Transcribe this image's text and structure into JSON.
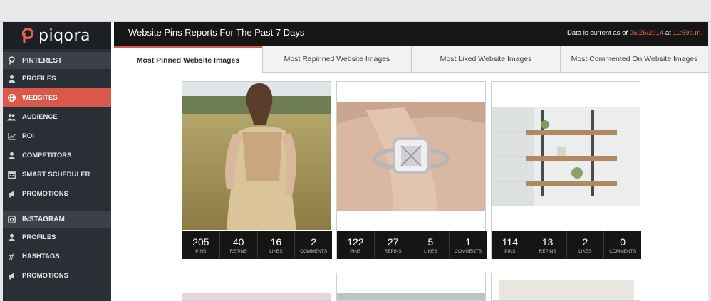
{
  "app": {
    "logo_text": "piqora"
  },
  "sidebar": {
    "pinterest_section": "PINTEREST",
    "pinterest_items": [
      {
        "label": "PROFILES"
      },
      {
        "label": "WEBSITES"
      },
      {
        "label": "AUDIENCE"
      },
      {
        "label": "ROI"
      },
      {
        "label": "COMPETITORS"
      },
      {
        "label": "SMART SCHEDULER"
      },
      {
        "label": "PROMOTIONS"
      }
    ],
    "instagram_section": "INSTAGRAM",
    "instagram_items": [
      {
        "label": "PROFILES"
      },
      {
        "label": "HASHTAGS"
      },
      {
        "label": "PROMOTIONS"
      }
    ]
  },
  "header": {
    "title": "Website Pins Reports For The Past 7 Days",
    "date_prefix": "Data is current as of",
    "date": "06/26/2014",
    "at": "at",
    "time": "11:59p.m."
  },
  "tabs": [
    {
      "label": "Most Pinned Website Images"
    },
    {
      "label": "Most Repinned Website Images"
    },
    {
      "label": "Most Liked Website Images"
    },
    {
      "label": "Most Commented On Website Images"
    }
  ],
  "stat_labels": {
    "pins": "PINS",
    "repins": "REPINS",
    "likes": "LIKES",
    "comments": "COMMENTS"
  },
  "cards": [
    {
      "pins": "205",
      "repins": "40",
      "likes": "16",
      "comments": "2"
    },
    {
      "pins": "122",
      "repins": "27",
      "likes": "5",
      "comments": "1"
    },
    {
      "pins": "114",
      "repins": "13",
      "likes": "2",
      "comments": "0"
    }
  ],
  "colors": {
    "accent": "#d8584a",
    "sidebar_bg": "#2a2f36",
    "header_bg": "#161616"
  }
}
